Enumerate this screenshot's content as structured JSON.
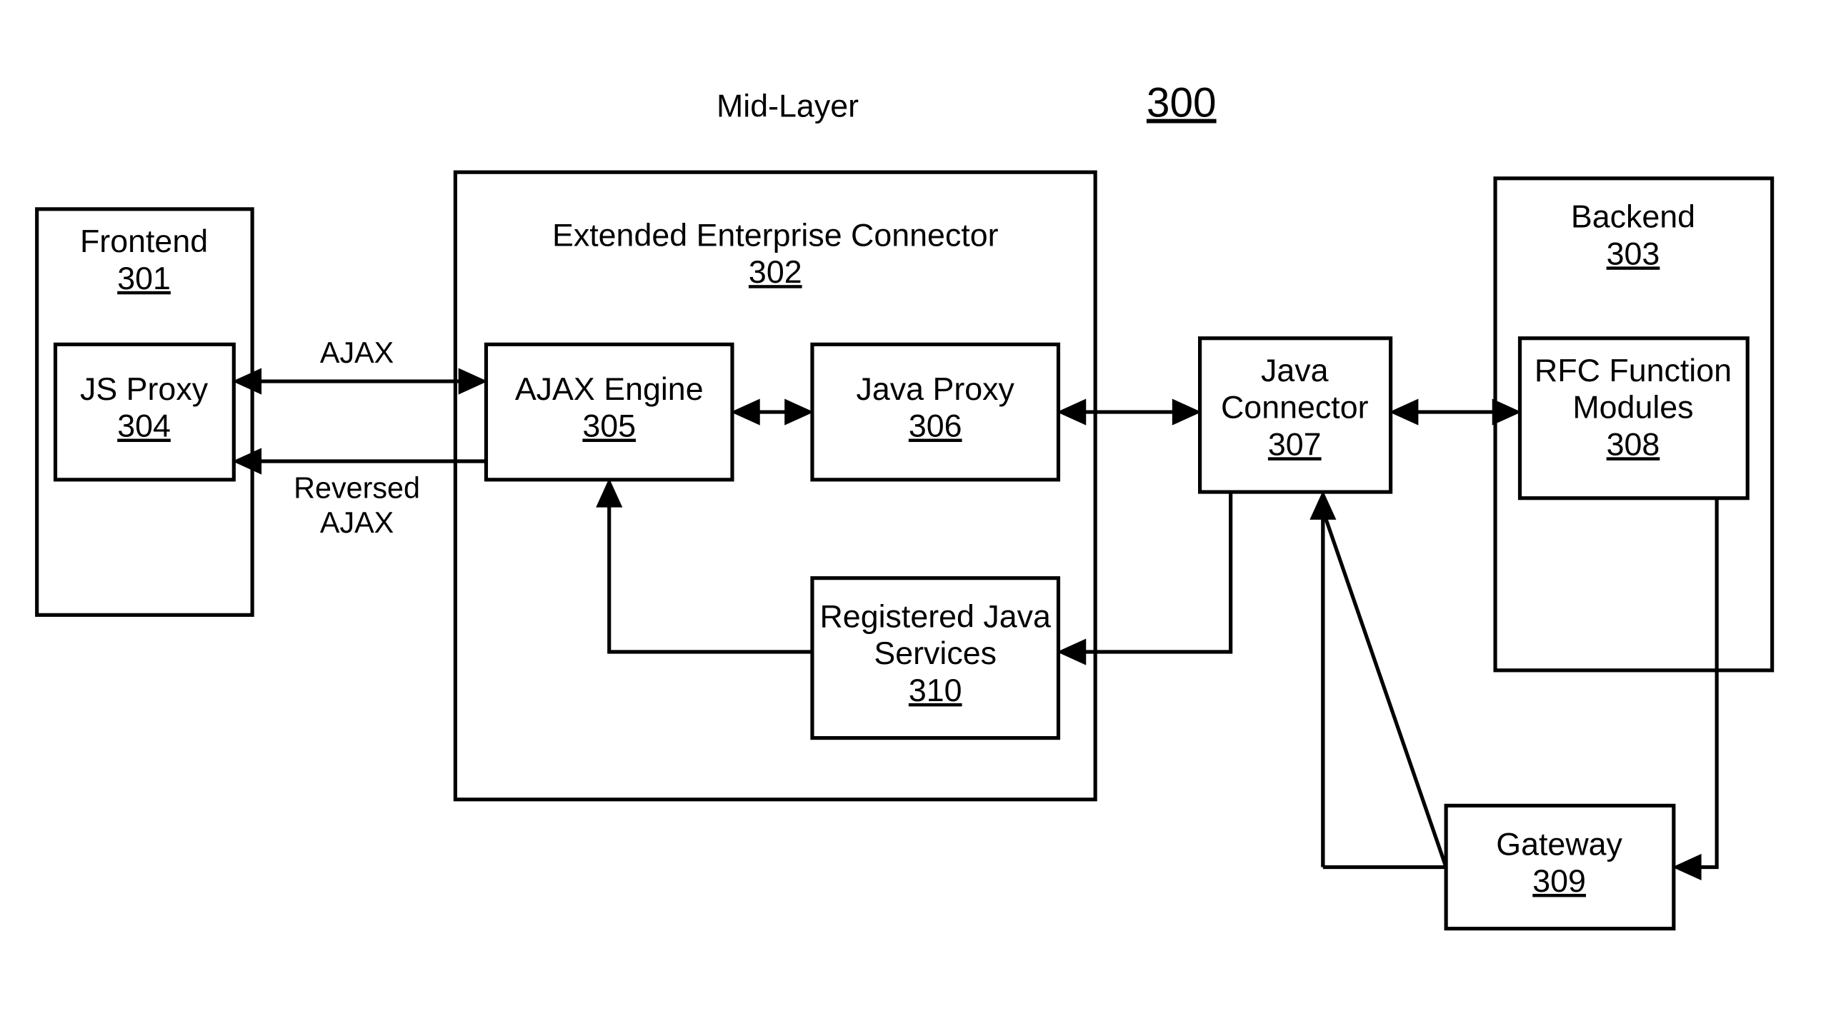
{
  "figure_number": "300",
  "labels": {
    "mid_layer": "Mid-Layer",
    "ajax": "AJAX",
    "reversed": "Reversed",
    "ajax2": "AJAX"
  },
  "boxes": {
    "frontend": {
      "title": "Frontend",
      "num": "301"
    },
    "eec": {
      "title": "Extended Enterprise Connector",
      "num": "302"
    },
    "backend": {
      "title": "Backend",
      "num": "303"
    },
    "jsproxy": {
      "title": "JS Proxy",
      "num": "304"
    },
    "ajax_eng": {
      "title": "AJAX Engine",
      "num": "305"
    },
    "javaproxy": {
      "title": "Java Proxy",
      "num": "306"
    },
    "jconn": {
      "title1": "Java",
      "title2": "Connector",
      "num": "307"
    },
    "rfc": {
      "title1": "RFC Function",
      "title2": "Modules",
      "num": "308"
    },
    "gateway": {
      "title": "Gateway",
      "num": "309"
    },
    "rjs": {
      "title1": "Registered Java",
      "title2": "Services",
      "num": "310"
    }
  }
}
